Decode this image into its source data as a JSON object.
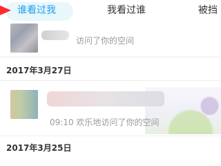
{
  "tabs": [
    {
      "label": "谁看过我",
      "active": true
    },
    {
      "label": "我看过谁",
      "active": false
    },
    {
      "label": "被挡",
      "active": false
    }
  ],
  "visits": [
    {
      "time": "",
      "text": "访问了你的空间",
      "date_header": "2017年3月27日"
    },
    {
      "time": "09:10",
      "name_fragment": "欢乐地",
      "text": "访问了你的空间",
      "date_header": "2017年3月25日"
    }
  ],
  "colors": {
    "active_tab": "#1aa2f0",
    "pointer_arrow": "#ff2b2b"
  }
}
